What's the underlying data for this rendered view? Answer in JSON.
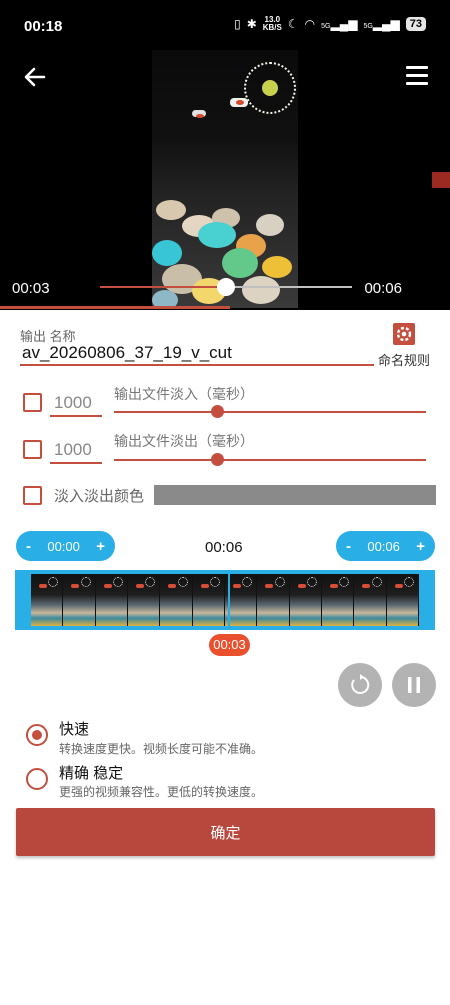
{
  "status_bar": {
    "time": "00:18",
    "net_speed_value": "13.0",
    "net_speed_unit": "KB/S",
    "signal1": "5G",
    "signal2": "5G",
    "battery": "73"
  },
  "player": {
    "current_time": "00:03",
    "end_time": "00:06",
    "progress_fraction": 0.5
  },
  "form": {
    "output_name_label": "输出 名称",
    "output_name_value": "av_20260806_37_19_v_cut",
    "naming_rule_label": "命名规则",
    "fade_in": {
      "value": "1000",
      "label": "输出文件淡入（毫秒）",
      "checked": false,
      "slider_fraction": 0.33
    },
    "fade_out": {
      "value": "1000",
      "label": "输出文件淡出（毫秒）",
      "checked": false,
      "slider_fraction": 0.33
    },
    "fade_color": {
      "label": "淡入淡出颜色",
      "checked": false,
      "color": "#8a8a8a"
    }
  },
  "trim": {
    "start": {
      "minus": "-",
      "value": "00:00",
      "plus": "+"
    },
    "duration": "00:06",
    "end": {
      "minus": "-",
      "value": "00:06",
      "plus": "+"
    },
    "position": "00:03",
    "frame_count": 12
  },
  "options": [
    {
      "title": "快速",
      "desc": "转换速度更快。视频长度可能不准确。",
      "selected": true
    },
    {
      "title": "精确 稳定",
      "desc": "更强的视频兼容性。更低的转换速度。",
      "selected": false
    }
  ],
  "confirm_label": "确定",
  "colors": {
    "accent": "#c44f3f",
    "trim_blue": "#2aaee6",
    "position_badge": "#e8502e",
    "confirm": "#b8473d"
  },
  "icons": [
    "back-arrow-icon",
    "menu-icon",
    "gear-icon",
    "reset-icon",
    "pause-icon"
  ]
}
